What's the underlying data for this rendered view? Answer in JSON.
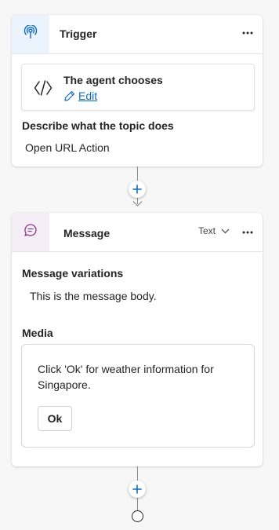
{
  "trigger_card": {
    "title": "Trigger",
    "icon": "trigger-icon",
    "accent_color": "#ebf3fc",
    "icon_color": "#0f6cbd",
    "trigger_type": {
      "icon": "code-icon",
      "title": "The agent chooses",
      "edit_label": "Edit"
    },
    "description_label": "Describe what the topic does",
    "description_value": "Open URL Action"
  },
  "message_card": {
    "title": "Message",
    "icon": "chat-bubble-icon",
    "accent_color": "#f5eef6",
    "icon_color": "#8a3a87",
    "format_label": "Text",
    "variations_label": "Message variations",
    "message_body": "This is the message body.",
    "media_label": "Media",
    "media_card": {
      "text": "Click 'Ok' for weather information for Singapore.",
      "button_label": "Ok"
    }
  },
  "colors": {
    "link": "#0f6cbd",
    "add_icon": "#0f6cbd"
  }
}
